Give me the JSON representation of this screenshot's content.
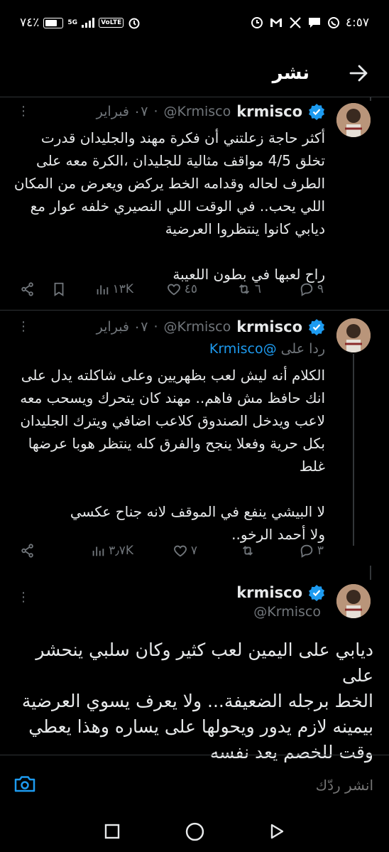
{
  "status_bar": {
    "time": "٤:٥٧",
    "battery": "٧٤٪",
    "network": "5G",
    "volte": "VoLTE"
  },
  "header": {
    "title": "نشر"
  },
  "tweets": [
    {
      "name": "krmisco",
      "handle": "@Krmisco",
      "date": "٠٧ فبراير",
      "dots": "⋮",
      "reply_to_prefix": "",
      "reply_to": "",
      "body_lines": [
        "أكثر حاجة زعلتني أن فكرة مهند والجليدان قدرت",
        "تخلق 4/5 مواقف مثالية للجليدان ،الكرة معه على",
        "الطرف لحاله وقدامه الخط يركض ويعرض من المكان",
        "اللي يحب.. في الوقت اللي النصيري خلفه عوار مع",
        "ديابي كانوا ينتظروا العرضية",
        "",
        "راح لعبها في بطون اللعيبة"
      ],
      "replies": "٩",
      "retweets": "٦",
      "likes": "٤٥",
      "views": "١٣K"
    },
    {
      "name": "krmisco",
      "handle": "@Krmisco",
      "date": "٠٧ فبراير",
      "dots": "⋮",
      "reply_to_prefix": "ردا على",
      "reply_to": "@Krmisco",
      "body_lines": [
        "الكلام أنه ليش لعب بظهريين وعلى شاكلته يدل على",
        "انك حافظ مش فاهم.. مهند كان يتحرك ويسحب معه",
        "لاعب ويدخل الصندوق كلاعب اضافي ويترك الجليدان",
        "بكل حرية وفعلا ينجح والفرق كله ينتظر هوبا عرضها",
        "غلط",
        "",
        "لا البيشي ينفع في الموقف لانه جناح عكسي",
        "ولا أحمد الرخو.."
      ],
      "replies": "٣",
      "retweets": "",
      "likes": "٧",
      "views": "٣٫٧K"
    }
  ],
  "main_tweet": {
    "name": "krmisco",
    "handle": "@Krmisco",
    "dots": "⋮",
    "body_lines": [
      "ديابي على اليمين لعب كثير وكان سلبي ينحشر على",
      "الخط برجله الضعيفة... ولا يعرف يسوي العرضية",
      "بيمينه لازم يدور ويحولها على يساره وهذا يعطي",
      "وقت للخصم يعد نفسه"
    ]
  },
  "composer": {
    "placeholder": "انشر ردّك"
  },
  "colors": {
    "background": "#000000",
    "text": "#e7e9ea",
    "muted": "#71767b",
    "accent": "#1d9bf0"
  },
  "icons": [
    "back-arrow-icon",
    "verified-icon",
    "reply-icon",
    "retweet-icon",
    "like-icon",
    "views-icon",
    "bookmark-icon",
    "share-icon",
    "camera-icon",
    "nav-back-icon",
    "nav-home-icon",
    "nav-recents-icon"
  ]
}
